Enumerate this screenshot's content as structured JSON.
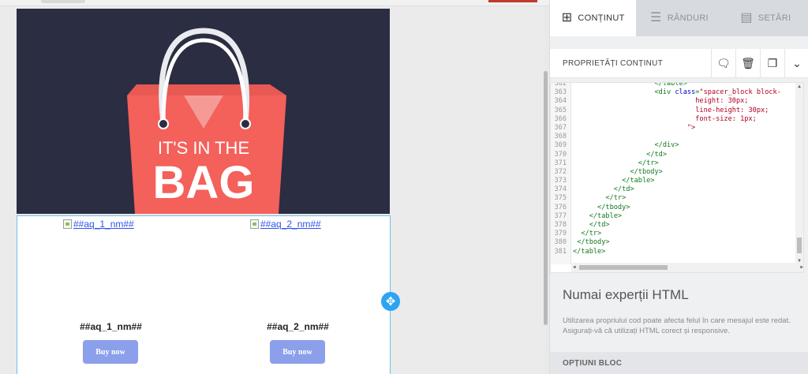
{
  "colors": {
    "hero_bg": "#2b2d42",
    "bag": "#f4605a",
    "bag_dark": "#d9484a",
    "accent_blue": "#2ea3f2",
    "button": "#8b9fea"
  },
  "hero": {
    "line1": "IT'S IN THE",
    "line2": "BAG"
  },
  "products": [
    {
      "image_alt": "##aq_1_nm##",
      "name": "##aq_1_nm##",
      "button": "Buy now"
    },
    {
      "image_alt": "##aq_2_nm##",
      "name": "##aq_2_nm##",
      "button": "Buy now"
    }
  ],
  "panel": {
    "tabs": [
      {
        "label": "CONȚINUT",
        "icon": "grid-icon",
        "glyph": "⊞",
        "active": true
      },
      {
        "label": "RÂNDURI",
        "icon": "rows-icon",
        "glyph": "☰",
        "active": false
      },
      {
        "label": "SETĂRI",
        "icon": "settings-doc-icon",
        "glyph": "▤",
        "active": false
      }
    ],
    "properties_title": "PROPRIETĂȚI CONȚINUT",
    "actions": [
      {
        "name": "comment-icon",
        "glyph": "🗨"
      },
      {
        "name": "trash-icon",
        "glyph": "🗑"
      },
      {
        "name": "duplicate-icon",
        "glyph": "❐"
      },
      {
        "name": "chevron-down-icon",
        "glyph": "⌄"
      }
    ],
    "code_lines": [
      {
        "n": "362",
        "indent": "                    ",
        "html": "</table>"
      },
      {
        "n": "363",
        "indent": "                    ",
        "tag": "<div ",
        "attr": "class",
        "eq": "=",
        "str": "\"spacer_block block-"
      },
      {
        "n": "364",
        "indent": "                              ",
        "str": "height: 30px;"
      },
      {
        "n": "365",
        "indent": "                              ",
        "str": "line-height: 30px;"
      },
      {
        "n": "366",
        "indent": "                              ",
        "str": "font-size: 1px;"
      },
      {
        "n": "367",
        "indent": "                            ",
        "str": "\">"
      },
      {
        "n": "368",
        "indent": "",
        "html": ""
      },
      {
        "n": "369",
        "indent": "                    ",
        "html": "</div>"
      },
      {
        "n": "370",
        "indent": "                  ",
        "html": "</td>"
      },
      {
        "n": "371",
        "indent": "                ",
        "html": "</tr>"
      },
      {
        "n": "372",
        "indent": "              ",
        "html": "</tbody>"
      },
      {
        "n": "373",
        "indent": "            ",
        "html": "</table>"
      },
      {
        "n": "374",
        "indent": "          ",
        "html": "</td>"
      },
      {
        "n": "375",
        "indent": "        ",
        "html": "</tr>"
      },
      {
        "n": "376",
        "indent": "      ",
        "html": "</tbody>"
      },
      {
        "n": "377",
        "indent": "    ",
        "html": "</table>"
      },
      {
        "n": "378",
        "indent": "    ",
        "html": "</td>"
      },
      {
        "n": "379",
        "indent": "  ",
        "html": "</tr>"
      },
      {
        "n": "380",
        "indent": " ",
        "html": "</tbody>"
      },
      {
        "n": "381",
        "indent": "",
        "html": "</table>"
      }
    ],
    "html_title": "Numai experții HTML",
    "html_description": "Utilizarea propriului cod poate afecta felul în care mesajul este redat. Asigurați-vă că utilizați HTML corect și responsive.",
    "block_options": "OPȚIUNI BLOC"
  }
}
